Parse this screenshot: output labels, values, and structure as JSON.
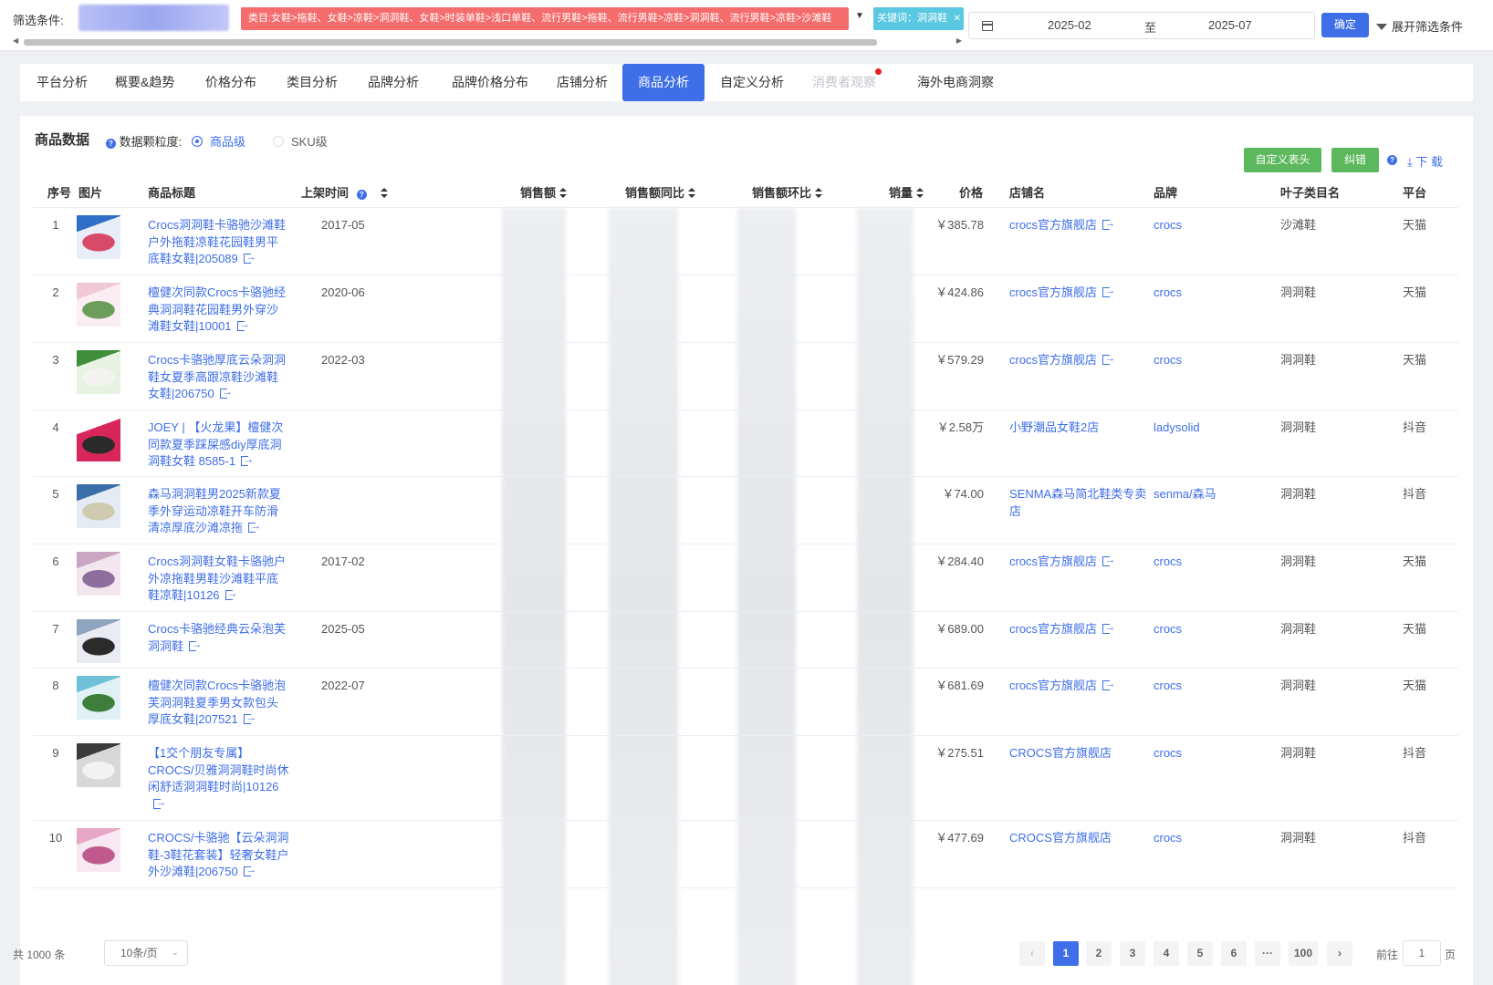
{
  "filter": {
    "label": "筛选条件:",
    "category_tag": "类目:女鞋>拖鞋、女鞋>凉鞋>洞洞鞋、女鞋>时装单鞋>浅口单鞋、流行男鞋>拖鞋、流行男鞋>凉鞋>洞洞鞋、流行男鞋>凉鞋>沙滩鞋",
    "keyword_tag": "关键词：洞洞鞋",
    "date_start": "2025-02",
    "date_sep": "至",
    "date_end": "2025-07",
    "confirm_label": "确定",
    "expand_label": "展开筛选条件"
  },
  "tabs": [
    {
      "label": "平台分析"
    },
    {
      "label": "概要&趋势"
    },
    {
      "label": "价格分布"
    },
    {
      "label": "类目分析"
    },
    {
      "label": "品牌分析"
    },
    {
      "label": "品牌价格分布"
    },
    {
      "label": "店铺分析"
    },
    {
      "label": "商品分析"
    },
    {
      "label": "自定义分析"
    },
    {
      "label": "消费者观察"
    },
    {
      "label": "海外电商洞察"
    }
  ],
  "active_tab": "商品分析",
  "panel": {
    "title": "商品数据",
    "granularity_label": "数据颗粒度:",
    "radio_item": "商品级",
    "radio_sku": "SKU级",
    "btn_custom_header": "自定义表头",
    "btn_correct": "纠错",
    "download_label": "下 载"
  },
  "table": {
    "headers": {
      "idx": "序号",
      "img": "图片",
      "title": "商品标题",
      "date": "上架时间",
      "sales": "销售额",
      "yoy": "销售额同比",
      "mom": "销售额环比",
      "volume": "销量",
      "price": "价格",
      "shop": "店铺名",
      "brand": "品牌",
      "leaf": "叶子类目名",
      "platform": "平台"
    },
    "rows": [
      {
        "idx": "1",
        "title": "Crocs洞洞鞋卡骆驰沙滩鞋户外拖鞋凉鞋花园鞋男平底鞋女鞋|205089",
        "date": "2017-05",
        "price": "￥385.78",
        "shop": "crocs官方旗舰店",
        "shop_link": true,
        "brand": "crocs",
        "leaf": "沙滩鞋",
        "platform": "天猫",
        "thumb": [
          "#2f6fc7",
          "#e8eef8",
          "#d84a6a"
        ]
      },
      {
        "idx": "2",
        "title": "檀健次同款Crocs卡骆驰经典洞洞鞋花园鞋男外穿沙滩鞋女鞋|10001",
        "date": "2020-06",
        "price": "￥424.86",
        "shop": "crocs官方旗舰店",
        "shop_link": true,
        "brand": "crocs",
        "leaf": "洞洞鞋",
        "platform": "天猫",
        "thumb": [
          "#f0c8d8",
          "#fbeef3",
          "#6a9e5a"
        ]
      },
      {
        "idx": "3",
        "title": "Crocs卡骆驰厚底云朵洞洞鞋女夏季高跟凉鞋沙滩鞋女鞋|206750",
        "date": "2022-03",
        "price": "￥579.29",
        "shop": "crocs官方旗舰店",
        "shop_link": true,
        "brand": "crocs",
        "leaf": "洞洞鞋",
        "platform": "天猫",
        "thumb": [
          "#3f8f3a",
          "#e8f2e2",
          "#f3f3f0"
        ]
      },
      {
        "idx": "4",
        "title": "JOEY | 【火龙果】檀健次同款夏季踩屎感diy厚底洞洞鞋女鞋 8585-1",
        "date": "",
        "price": "￥2.58万",
        "shop": "小野潮品女鞋2店",
        "shop_link": false,
        "brand": "ladysolid",
        "leaf": "洞洞鞋",
        "platform": "抖音",
        "thumb": [
          "#ffffff",
          "#d8265a",
          "#2a2a2a"
        ]
      },
      {
        "idx": "5",
        "title": "森马洞洞鞋男2025新款夏季外穿运动凉鞋开车防滑清凉厚底沙滩凉拖",
        "date": "",
        "price": "￥74.00",
        "shop": "SENMA森马简北鞋类专卖店",
        "shop_link": false,
        "brand": "senma/森马",
        "leaf": "洞洞鞋",
        "platform": "抖音",
        "thumb": [
          "#3a6ea8",
          "#e5ebf3",
          "#cfcab0"
        ]
      },
      {
        "idx": "6",
        "title": "Crocs洞洞鞋女鞋卡骆驰户外凉拖鞋男鞋沙滩鞋平底鞋凉鞋|10126",
        "date": "2017-02",
        "price": "￥284.40",
        "shop": "crocs官方旗舰店",
        "shop_link": true,
        "brand": "crocs",
        "leaf": "洞洞鞋",
        "platform": "天猫",
        "thumb": [
          "#c9a7c2",
          "#f3e6ef",
          "#8c6f9c"
        ]
      },
      {
        "idx": "7",
        "title": "Crocs卡骆驰经典云朵泡芙洞洞鞋",
        "date": "2025-05",
        "price": "￥689.00",
        "shop": "crocs官方旗舰店",
        "shop_link": true,
        "brand": "crocs",
        "leaf": "洞洞鞋",
        "platform": "天猫",
        "thumb": [
          "#8fa4bf",
          "#e9edf3",
          "#2b2b2b"
        ]
      },
      {
        "idx": "8",
        "title": "檀健次同款Crocs卡骆驰泡芙洞洞鞋夏季男女款包头厚底女鞋|207521",
        "date": "2022-07",
        "price": "￥681.69",
        "shop": "crocs官方旗舰店",
        "shop_link": true,
        "brand": "crocs",
        "leaf": "洞洞鞋",
        "platform": "天猫",
        "thumb": [
          "#6fc1d8",
          "#e0f1f6",
          "#3f7e3a"
        ]
      },
      {
        "idx": "9",
        "title": "【1交个朋友专属】CROCS/贝雅洞洞鞋时尚休闲舒适洞洞鞋时尚|10126",
        "date": "",
        "price": "￥275.51",
        "shop": "CROCS官方旗舰店",
        "shop_link": false,
        "brand": "crocs",
        "leaf": "洞洞鞋",
        "platform": "抖音",
        "thumb": [
          "#3b3b3b",
          "#d8d8d8",
          "#f2f2f2"
        ]
      },
      {
        "idx": "10",
        "title": "CROCS/卡骆驰【云朵洞洞鞋-3鞋花套装】轻奢女鞋户外沙滩鞋|206750",
        "date": "",
        "price": "￥477.69",
        "shop": "CROCS官方旗舰店",
        "shop_link": false,
        "brand": "crocs",
        "leaf": "洞洞鞋",
        "platform": "抖音",
        "thumb": [
          "#e7a6c6",
          "#f8e8f1",
          "#c05a8e"
        ]
      }
    ]
  },
  "pagination": {
    "total": "共 1000 条",
    "page_size": "10条/页",
    "pages": [
      "1",
      "2",
      "3",
      "4",
      "5",
      "6",
      "···",
      "100"
    ],
    "current": "1",
    "goto_label": "前往",
    "goto_value": "1",
    "goto_suffix": "页"
  },
  "colors": {
    "accent": "#3e6ee8",
    "category_tag_bg": "#f56c6c",
    "keyword_tag_bg": "#5ac8e0",
    "button_green": "#5cb85c",
    "notification_dot": "#e91e1e"
  }
}
